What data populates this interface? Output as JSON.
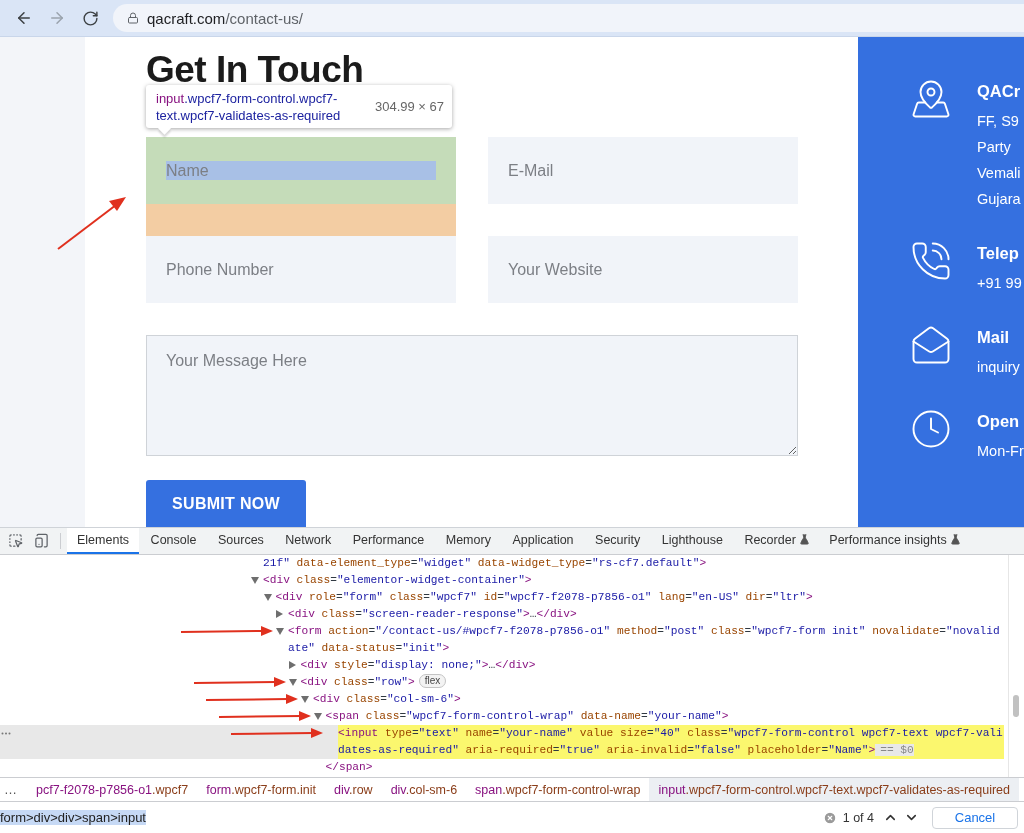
{
  "browser": {
    "url_host": "qacraft.com",
    "url_path": "/contact-us/",
    "forward_disabled": true
  },
  "page": {
    "title": "Get In Touch",
    "inspect_tooltip": {
      "tag": "input",
      "classes": ".wpcf7-form-control.wpcf7-text.wpcf7-validates-as-required",
      "size": "304.99 × 67"
    },
    "fields": [
      {
        "kind": "input",
        "placeholder": "Name",
        "inspected": true
      },
      {
        "kind": "input",
        "placeholder": "E-Mail",
        "inspected": false
      },
      {
        "kind": "input",
        "placeholder": "Phone Number",
        "inspected": false
      },
      {
        "kind": "input",
        "placeholder": "Your Website",
        "inspected": false
      },
      {
        "kind": "textarea",
        "placeholder": "Your Message Here",
        "inspected": false
      }
    ],
    "submit_label": "SUBMIT NOW"
  },
  "contact_panel": {
    "items": [
      {
        "kind": "address",
        "title": "QACr",
        "lines": [
          "FF, S9",
          "Party",
          "Vemali",
          "Gujara"
        ]
      },
      {
        "kind": "phone",
        "title": "Telep",
        "lines": [
          "+91 99"
        ]
      },
      {
        "kind": "mail",
        "title": "Mail",
        "lines": [
          "inquiry"
        ]
      },
      {
        "kind": "hours",
        "title": "Open",
        "lines": [
          "Mon-Fr"
        ]
      }
    ]
  },
  "devtools": {
    "tabs": [
      {
        "label": "Elements",
        "selected": true,
        "experimental": false
      },
      {
        "label": "Console",
        "selected": false,
        "experimental": false
      },
      {
        "label": "Sources",
        "selected": false,
        "experimental": false
      },
      {
        "label": "Network",
        "selected": false,
        "experimental": false
      },
      {
        "label": "Performance",
        "selected": false,
        "experimental": false
      },
      {
        "label": "Memory",
        "selected": false,
        "experimental": false
      },
      {
        "label": "Application",
        "selected": false,
        "experimental": false
      },
      {
        "label": "Security",
        "selected": false,
        "experimental": false
      },
      {
        "label": "Lighthouse",
        "selected": false,
        "experimental": false
      },
      {
        "label": "Recorder",
        "selected": false,
        "experimental": true
      },
      {
        "label": "Performance insights",
        "selected": false,
        "experimental": true
      }
    ],
    "dom_tree": [
      {
        "selected": false,
        "arrow": false,
        "segments": [
          {
            "kind": "value",
            "text": "21f\""
          },
          {
            "kind": "attr",
            "text": " data-element_type"
          },
          {
            "kind": "text",
            "text": "="
          },
          {
            "kind": "value",
            "text": "\"widget\""
          },
          {
            "kind": "attr",
            "text": " data-widget_type"
          },
          {
            "kind": "text",
            "text": "="
          },
          {
            "kind": "value",
            "text": "\"rs-cf7.default\""
          },
          {
            "kind": "tag",
            "text": ">"
          }
        ]
      },
      {
        "expanded": true,
        "selected": false,
        "arrow": false,
        "segments": [
          {
            "kind": "tag",
            "text": "<div"
          },
          {
            "kind": "attr",
            "text": " class"
          },
          {
            "kind": "text",
            "text": "="
          },
          {
            "kind": "value",
            "text": "\"elementor-widget-container\""
          },
          {
            "kind": "tag",
            "text": ">"
          }
        ],
        "children": [
          {
            "expanded": true,
            "selected": false,
            "arrow": false,
            "segments": [
              {
                "kind": "tag",
                "text": "<div"
              },
              {
                "kind": "attr",
                "text": " role"
              },
              {
                "kind": "text",
                "text": "="
              },
              {
                "kind": "value",
                "text": "\"form\""
              },
              {
                "kind": "attr",
                "text": " class"
              },
              {
                "kind": "text",
                "text": "="
              },
              {
                "kind": "value",
                "text": "\"wpcf7\""
              },
              {
                "kind": "attr",
                "text": " id"
              },
              {
                "kind": "text",
                "text": "="
              },
              {
                "kind": "value",
                "text": "\"wpcf7-f2078-p7856-o1\""
              },
              {
                "kind": "attr",
                "text": " lang"
              },
              {
                "kind": "text",
                "text": "="
              },
              {
                "kind": "value",
                "text": "\"en-US\""
              },
              {
                "kind": "attr",
                "text": " dir"
              },
              {
                "kind": "text",
                "text": "="
              },
              {
                "kind": "value",
                "text": "\"ltr\""
              },
              {
                "kind": "tag",
                "text": ">"
              }
            ],
            "children": [
              {
                "expanded": false,
                "selected": false,
                "arrow": false,
                "segments": [
                  {
                    "kind": "tag",
                    "text": "<div"
                  },
                  {
                    "kind": "attr",
                    "text": " class"
                  },
                  {
                    "kind": "text",
                    "text": "="
                  },
                  {
                    "kind": "value",
                    "text": "\"screen-reader-response\""
                  },
                  {
                    "kind": "tag",
                    "text": ">"
                  },
                  {
                    "kind": "text",
                    "text": "…"
                  },
                  {
                    "kind": "tag",
                    "text": "</div>"
                  }
                ]
              },
              {
                "expanded": true,
                "selected": false,
                "arrow": true,
                "segments": [
                  {
                    "kind": "tag",
                    "text": "<form"
                  },
                  {
                    "kind": "attr",
                    "text": " action"
                  },
                  {
                    "kind": "text",
                    "text": "="
                  },
                  {
                    "kind": "value",
                    "text": "\"/contact-us/#wpcf7-f2078-p7856-o1\""
                  },
                  {
                    "kind": "attr",
                    "text": " method"
                  },
                  {
                    "kind": "text",
                    "text": "="
                  },
                  {
                    "kind": "value",
                    "text": "\"post\""
                  },
                  {
                    "kind": "attr",
                    "text": " class"
                  },
                  {
                    "kind": "text",
                    "text": "="
                  },
                  {
                    "kind": "value",
                    "text": "\"wpcf7-form init\""
                  },
                  {
                    "kind": "attr",
                    "text": " novalidate"
                  },
                  {
                    "kind": "text",
                    "text": "="
                  },
                  {
                    "kind": "value",
                    "text": "\"novalidate\""
                  },
                  {
                    "kind": "attr",
                    "text": " data-status"
                  },
                  {
                    "kind": "text",
                    "text": "="
                  },
                  {
                    "kind": "value",
                    "text": "\"init\""
                  },
                  {
                    "kind": "tag",
                    "text": ">"
                  }
                ],
                "children": [
                  {
                    "expanded": false,
                    "selected": false,
                    "arrow": false,
                    "segments": [
                      {
                        "kind": "tag",
                        "text": "<div"
                      },
                      {
                        "kind": "attr",
                        "text": " style"
                      },
                      {
                        "kind": "text",
                        "text": "="
                      },
                      {
                        "kind": "value",
                        "text": "\"display: none;\""
                      },
                      {
                        "kind": "tag",
                        "text": ">"
                      },
                      {
                        "kind": "text",
                        "text": "…"
                      },
                      {
                        "kind": "tag",
                        "text": "</div>"
                      }
                    ]
                  },
                  {
                    "expanded": true,
                    "selected": false,
                    "arrow": true,
                    "badge": "flex",
                    "segments": [
                      {
                        "kind": "tag",
                        "text": "<div"
                      },
                      {
                        "kind": "attr",
                        "text": " class"
                      },
                      {
                        "kind": "text",
                        "text": "="
                      },
                      {
                        "kind": "value",
                        "text": "\"row\""
                      },
                      {
                        "kind": "tag",
                        "text": ">"
                      }
                    ],
                    "children": [
                      {
                        "expanded": true,
                        "selected": false,
                        "arrow": true,
                        "segments": [
                          {
                            "kind": "tag",
                            "text": "<div"
                          },
                          {
                            "kind": "attr",
                            "text": " class"
                          },
                          {
                            "kind": "text",
                            "text": "="
                          },
                          {
                            "kind": "value",
                            "text": "\"col-sm-6\""
                          },
                          {
                            "kind": "tag",
                            "text": ">"
                          }
                        ],
                        "children": [
                          {
                            "expanded": true,
                            "selected": false,
                            "arrow": true,
                            "segments": [
                              {
                                "kind": "tag",
                                "text": "<span"
                              },
                              {
                                "kind": "attr",
                                "text": " class"
                              },
                              {
                                "kind": "text",
                                "text": "="
                              },
                              {
                                "kind": "value",
                                "text": "\"wpcf7-form-control-wrap\""
                              },
                              {
                                "kind": "attr",
                                "text": " data-name"
                              },
                              {
                                "kind": "text",
                                "text": "="
                              },
                              {
                                "kind": "value",
                                "text": "\"your-name\""
                              },
                              {
                                "kind": "tag",
                                "text": ">"
                              }
                            ],
                            "closing": [
                              {
                                "kind": "tag",
                                "text": "</span>"
                              }
                            ],
                            "children": [
                              {
                                "selected": true,
                                "arrow": true,
                                "console_ref": "== $0",
                                "segments": [
                                  {
                                    "kind": "tag",
                                    "text": "<input"
                                  },
                                  {
                                    "kind": "attr",
                                    "text": " type"
                                  },
                                  {
                                    "kind": "text",
                                    "text": "="
                                  },
                                  {
                                    "kind": "value",
                                    "text": "\"text\""
                                  },
                                  {
                                    "kind": "attr",
                                    "text": " name"
                                  },
                                  {
                                    "kind": "text",
                                    "text": "="
                                  },
                                  {
                                    "kind": "value",
                                    "text": "\"your-name\""
                                  },
                                  {
                                    "kind": "attr",
                                    "text": " value"
                                  },
                                  {
                                    "kind": "attr",
                                    "text": " size"
                                  },
                                  {
                                    "kind": "text",
                                    "text": "="
                                  },
                                  {
                                    "kind": "value",
                                    "text": "\"40\""
                                  },
                                  {
                                    "kind": "attr",
                                    "text": " class"
                                  },
                                  {
                                    "kind": "text",
                                    "text": "="
                                  },
                                  {
                                    "kind": "value",
                                    "text": "\"wpcf7-form-control wpcf7-text wpcf7-validates-as-required\""
                                  },
                                  {
                                    "kind": "attr",
                                    "text": " aria-required"
                                  },
                                  {
                                    "kind": "text",
                                    "text": "="
                                  },
                                  {
                                    "kind": "value",
                                    "text": "\"true\""
                                  },
                                  {
                                    "kind": "attr",
                                    "text": " aria-invalid"
                                  },
                                  {
                                    "kind": "text",
                                    "text": "="
                                  },
                                  {
                                    "kind": "value",
                                    "text": "\"false\""
                                  },
                                  {
                                    "kind": "attr",
                                    "text": " placeholder"
                                  },
                                  {
                                    "kind": "text",
                                    "text": "="
                                  },
                                  {
                                    "kind": "value",
                                    "text": "\"Name\""
                                  },
                                  {
                                    "kind": "tag",
                                    "text": ">"
                                  }
                                ]
                              }
                            ]
                          }
                        ]
                      }
                    ]
                  }
                ]
              }
            ]
          }
        ]
      }
    ],
    "breadcrumbs": {
      "overflow": "…",
      "items": [
        {
          "tag": "pcf7-f2078-p7856-o1",
          "cls": ".wpcf7",
          "selected": false
        },
        {
          "tag": "form",
          "cls": ".wpcf7-form.init",
          "selected": false
        },
        {
          "tag": "div",
          "cls": ".row",
          "selected": false
        },
        {
          "tag": "div",
          "cls": ".col-sm-6",
          "selected": false
        },
        {
          "tag": "span",
          "cls": ".wpcf7-form-control-wrap",
          "selected": false
        },
        {
          "tag": "input",
          "cls": ".wpcf7-form-control.wpcf7-text.wpcf7-validates-as-required",
          "selected": true
        }
      ]
    },
    "search": {
      "query": "form>div>div>span>input",
      "match_count": "1 of 4",
      "cancel_label": "Cancel"
    }
  }
}
